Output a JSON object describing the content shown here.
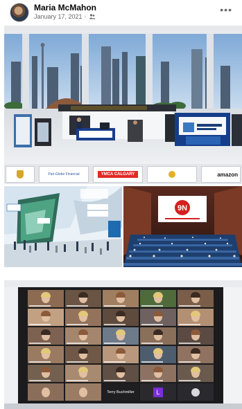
{
  "post": {
    "author": "Maria McMahon",
    "date": "January 17, 2021",
    "privacy_dot": "·",
    "more": "•••"
  },
  "photo1": {
    "banners": [
      "",
      "Pan-Globe Financial",
      "YMCA CALGARY",
      "",
      "amazon"
    ],
    "ymca_color": "#e12b26"
  },
  "photo3": {
    "logo": "9N"
  },
  "photo4": {
    "participants": [
      {
        "name": "",
        "c": "#8c6b52"
      },
      {
        "name": "",
        "c": "#6a5443"
      },
      {
        "name": "",
        "c": "#a07f60"
      },
      {
        "name": "",
        "c": "#4f6b3c"
      },
      {
        "name": "",
        "c": "#7a5e4a"
      },
      {
        "name": "",
        "c": "#c2a183"
      },
      {
        "name": "",
        "c": "#93735b"
      },
      {
        "name": "",
        "c": "#5e4b3d"
      },
      {
        "name": "",
        "c": "#6e6160"
      },
      {
        "name": "",
        "c": "#b39074"
      },
      {
        "name": "",
        "c": "#7d6151"
      },
      {
        "name": "",
        "c": "#a3866d"
      },
      {
        "name": "",
        "c": "#6d7a8a"
      },
      {
        "name": "",
        "c": "#8a6f5a"
      },
      {
        "name": "",
        "c": "#5b4a42"
      },
      {
        "name": "",
        "c": "#9a7b62"
      },
      {
        "name": "",
        "c": "#6f5847"
      },
      {
        "name": "",
        "c": "#b8977c"
      },
      {
        "name": "",
        "c": "#4d5d6e"
      },
      {
        "name": "",
        "c": "#8f7260"
      },
      {
        "name": "",
        "c": "#74604f"
      },
      {
        "name": "",
        "c": "#a88a70"
      },
      {
        "name": "",
        "c": "#5f4f44"
      },
      {
        "name": "",
        "c": "#8d7262"
      },
      {
        "name": "",
        "c": "#6a5a4e"
      }
    ],
    "bottom_row": {
      "name_tile": "Terry Buchmiller",
      "letter": "L"
    }
  }
}
